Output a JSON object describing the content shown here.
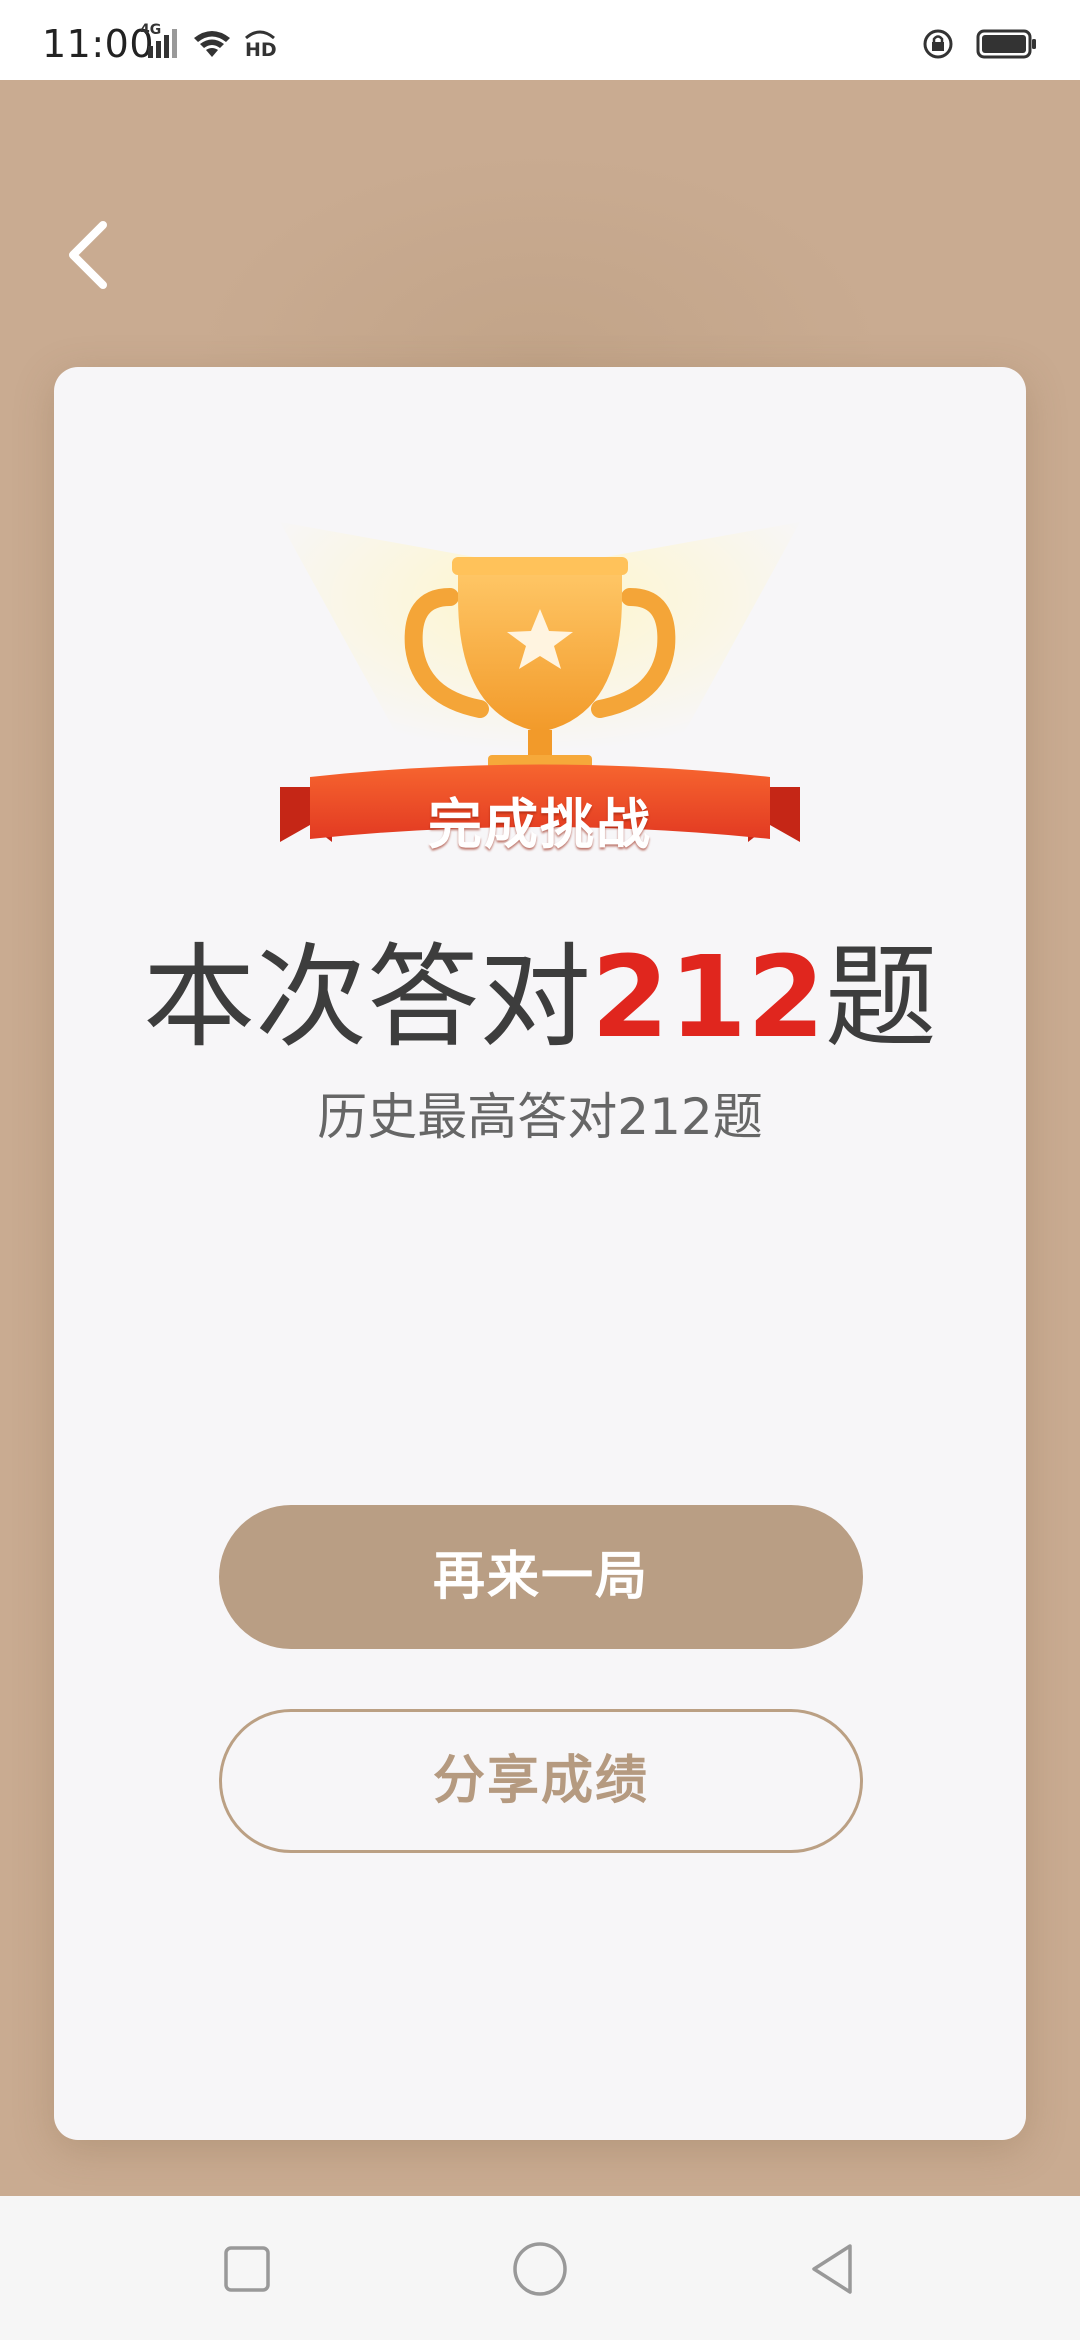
{
  "status_bar": {
    "time": "11:00",
    "network": "4G",
    "hd": "HD",
    "icons": [
      "signal-icon",
      "wifi-icon",
      "hd-icon",
      "rotation-lock-icon",
      "battery-icon"
    ]
  },
  "header": {
    "back_icon": "chevron-left-icon"
  },
  "result": {
    "badge_label": "完成挑战",
    "score_prefix": "本次答对",
    "score_value": "212",
    "score_suffix": "题",
    "history_text": "历史最高答对212题"
  },
  "actions": {
    "play_again_label": "再来一局",
    "share_label": "分享成绩"
  },
  "nav_bar": {
    "items": [
      "recents-icon",
      "home-icon",
      "back-icon"
    ]
  },
  "colors": {
    "background": "#c9ab91",
    "card": "#f7f6f8",
    "accent": "#b99e84",
    "score_red": "#e0261e",
    "ribbon_red": "#e8412b",
    "trophy_gold": "#f6a93a"
  }
}
